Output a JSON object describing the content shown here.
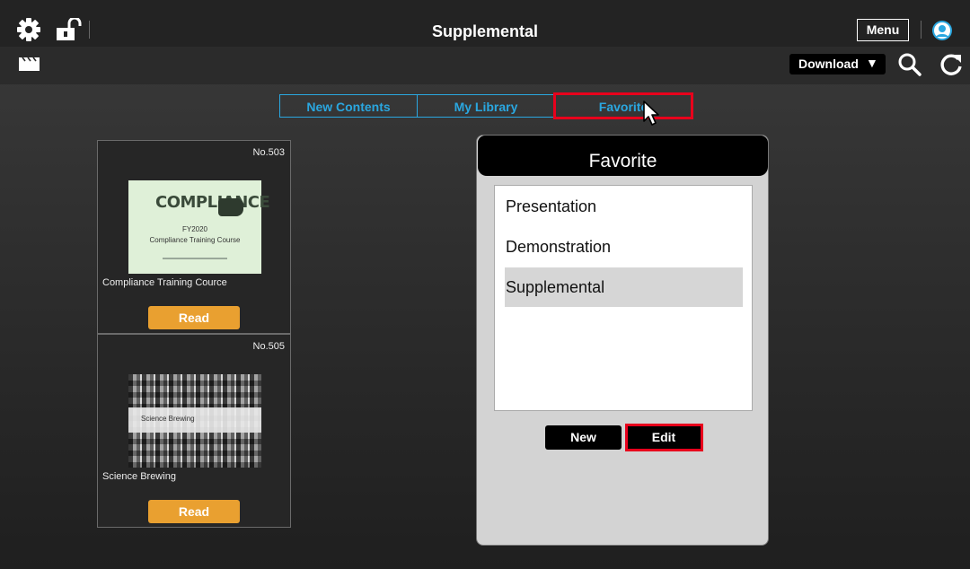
{
  "header": {
    "title": "Supplemental",
    "menu_label": "Menu"
  },
  "toolbar": {
    "download_label": "Download",
    "download_arrow": "▼"
  },
  "tabs": [
    {
      "label": "New Contents"
    },
    {
      "label": "My Library"
    },
    {
      "label": "Favorite",
      "selected": true
    }
  ],
  "cards": [
    {
      "number": "No.503",
      "name": "Compliance Training Cource",
      "read_label": "Read",
      "thumb": {
        "heading": "COMPLIANCE",
        "line1": "FY2020",
        "line2": "Compliance Training Course"
      }
    },
    {
      "number": "No.505",
      "name": "Science Brewing",
      "read_label": "Read",
      "thumb": {
        "caption": "Science Brewing"
      }
    }
  ],
  "favorite_panel": {
    "title": "Favorite",
    "items": [
      {
        "label": "Presentation"
      },
      {
        "label": "Demonstration"
      },
      {
        "label": "Supplemental",
        "selected": true
      }
    ],
    "new_label": "New",
    "edit_label": "Edit"
  },
  "colors": {
    "accent": "#2aa7e0",
    "read_button": "#e9a030",
    "highlight": "#e8001c"
  },
  "icons": [
    "gear-icon",
    "unlock-icon",
    "clapperboard-icon",
    "search-icon",
    "refresh-icon",
    "user-icon",
    "cursor-icon"
  ]
}
